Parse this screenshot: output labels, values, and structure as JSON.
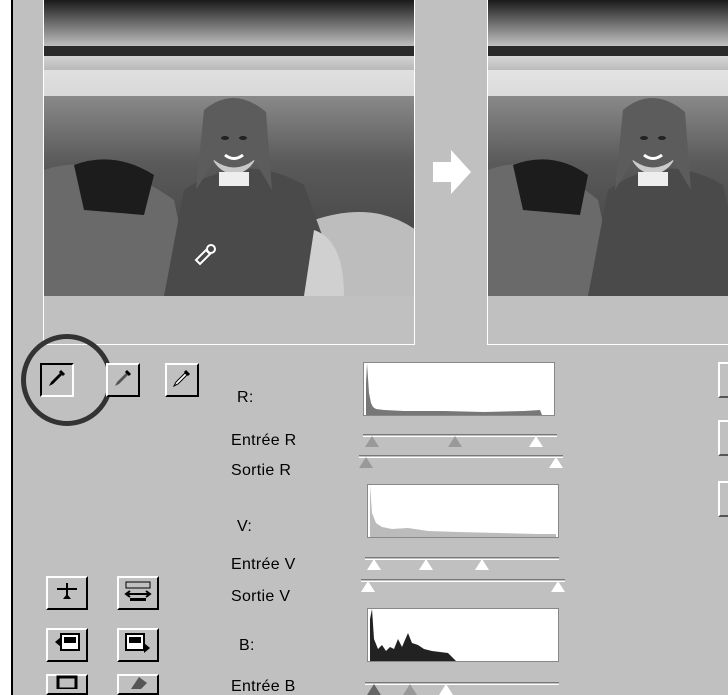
{
  "arrow_color": "#ffffff",
  "eyedroppers": [
    {
      "icon": "eyedropper-black-icon",
      "state": "selected"
    },
    {
      "icon": "eyedropper-gray-icon",
      "state": "normal"
    },
    {
      "icon": "eyedropper-white-icon",
      "state": "normal"
    }
  ],
  "channels": {
    "r": {
      "label": "R:",
      "input_label": "Entrée R",
      "output_label": "Sortie R"
    },
    "v": {
      "label": "V:",
      "input_label": "Entrée V",
      "output_label": "Sortie V"
    },
    "b": {
      "label": "B:",
      "input_label": "Entrée B"
    }
  },
  "left_tools": [
    {
      "icon": "reset-curve-icon"
    },
    {
      "icon": "auto-levels-icon"
    },
    {
      "icon": "load-settings-icon"
    },
    {
      "icon": "save-settings-icon"
    },
    {
      "icon": "frame-icon"
    },
    {
      "icon": "color-edit-icon"
    }
  ]
}
